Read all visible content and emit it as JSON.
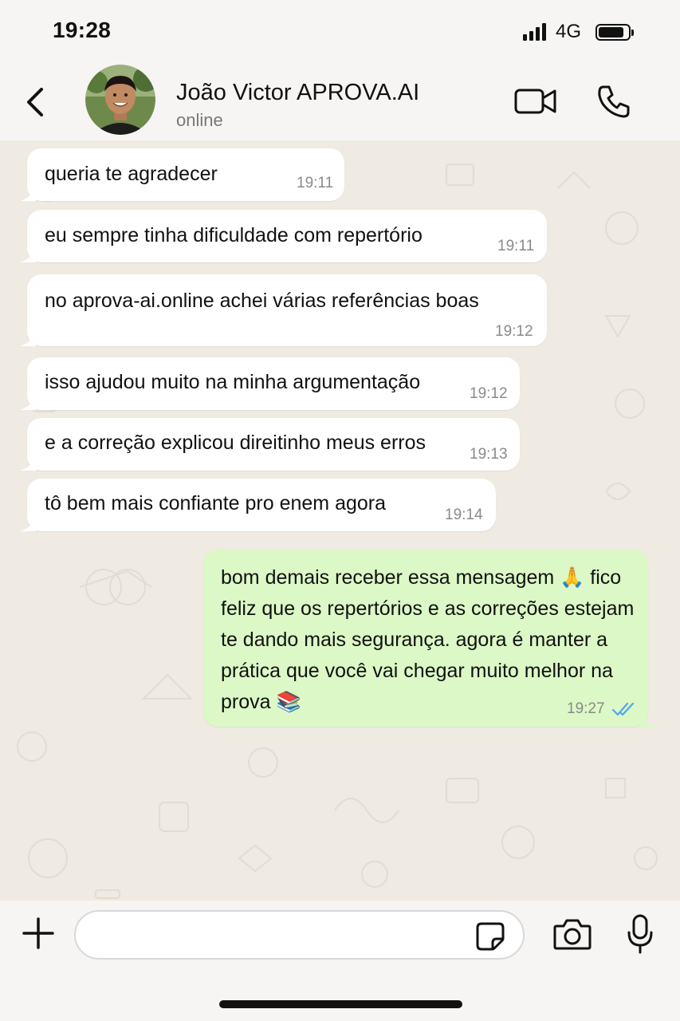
{
  "status_bar": {
    "time": "19:28",
    "network": "4G",
    "battery_level": 0.85
  },
  "header": {
    "contact_name": "João Victor APROVA.AI",
    "contact_status": "online",
    "icons": {
      "back": "chevron-left-icon",
      "video": "video-camera-icon",
      "call": "phone-icon"
    }
  },
  "messages": [
    {
      "direction": "incoming",
      "text": "queria te agradecer",
      "time": "19:11"
    },
    {
      "direction": "incoming",
      "text": "eu sempre tinha dificuldade com repertório",
      "time": "19:11"
    },
    {
      "direction": "incoming",
      "text": "no aprova-ai.online achei várias referências boas",
      "time": "19:12"
    },
    {
      "direction": "incoming",
      "text": "isso ajudou muito na minha argumentação",
      "time": "19:12"
    },
    {
      "direction": "incoming",
      "text": "e a correção explicou direitinho meus erros",
      "time": "19:13"
    },
    {
      "direction": "incoming",
      "text": "tô bem mais confiante pro enem agora",
      "time": "19:14"
    },
    {
      "direction": "outgoing",
      "text": "bom demais receber essa mensagem 🙏 fico feliz que os repertórios e as correções estejam te dando mais segurança. agora é manter a prática que você vai chegar muito melhor na prova 📚",
      "time": "19:27",
      "read": true
    }
  ],
  "input_bar": {
    "placeholder": "",
    "icons": {
      "plus": "plus-icon",
      "sticker": "sticker-icon",
      "camera": "camera-icon",
      "mic": "microphone-icon"
    }
  },
  "colors": {
    "chat_background": "#efeae2",
    "incoming_bubble": "#ffffff",
    "outgoing_bubble": "#dbf8c6",
    "read_ticks": "#53a6f0",
    "bar_background": "#f6f5f3"
  }
}
